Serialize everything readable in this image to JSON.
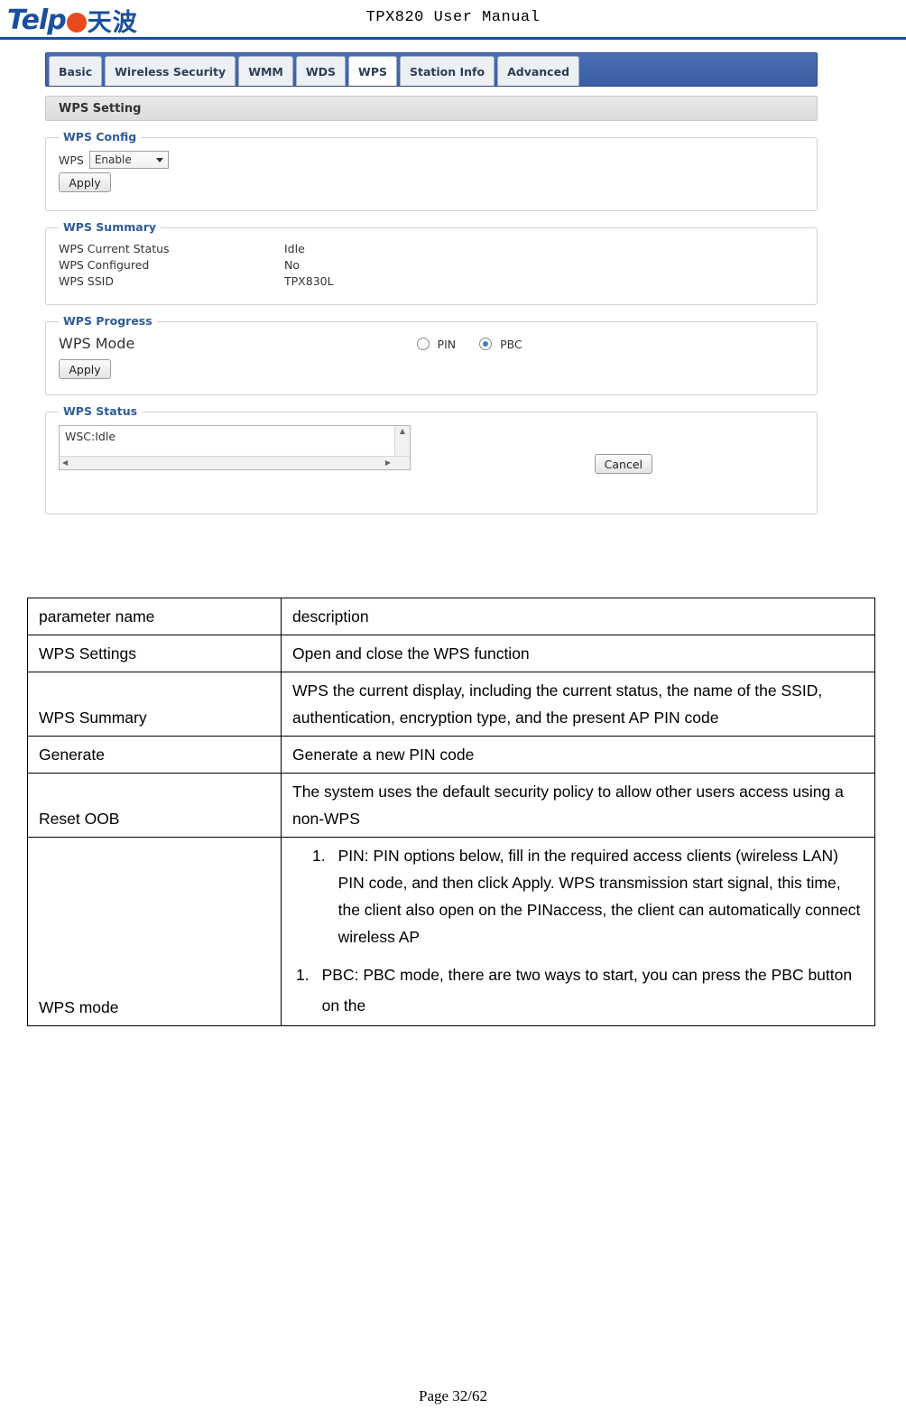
{
  "header": {
    "logo_text": "Telp",
    "logo_cn": "天波",
    "title": "TPX820 User Manual"
  },
  "screenshot": {
    "tabs": [
      {
        "label": "Basic",
        "active": false
      },
      {
        "label": "Wireless Security",
        "active": false
      },
      {
        "label": "WMM",
        "active": false
      },
      {
        "label": "WDS",
        "active": false
      },
      {
        "label": "WPS",
        "active": true
      },
      {
        "label": "Station Info",
        "active": false
      },
      {
        "label": "Advanced",
        "active": false
      }
    ],
    "section_title": "WPS Setting",
    "wps_config": {
      "legend": "WPS Config",
      "label": "WPS",
      "select_value": "Enable",
      "apply_label": "Apply"
    },
    "wps_summary": {
      "legend": "WPS Summary",
      "rows": [
        {
          "key": "WPS Current Status",
          "value": "Idle"
        },
        {
          "key": "WPS Configured",
          "value": "No"
        },
        {
          "key": "WPS SSID",
          "value": "TPX830L"
        }
      ]
    },
    "wps_progress": {
      "legend": "WPS Progress",
      "label": "WPS Mode",
      "options": [
        {
          "label": "PIN",
          "selected": false
        },
        {
          "label": "PBC",
          "selected": true
        }
      ],
      "apply_label": "Apply"
    },
    "wps_status": {
      "legend": "WPS Status",
      "text": "WSC:Idle",
      "cancel_label": "Cancel"
    }
  },
  "table": {
    "head": {
      "param": "parameter name",
      "desc": "description"
    },
    "rows": [
      {
        "param": "WPS Settings",
        "desc": "Open and close the WPS function"
      },
      {
        "param": "WPS Summary",
        "desc": "WPS the current display, including the current status, the name of the SSID, authentication, encryption type, and the present AP PIN code"
      },
      {
        "param": "Generate",
        "desc": "Generate a new PIN code"
      },
      {
        "param": "Reset OOB",
        "desc": "The system uses the default security policy to allow other users access using a non-WPS"
      }
    ],
    "wps_mode": {
      "param": "WPS mode",
      "item1_num": "1.",
      "item1_text": "PIN: PIN options below, fill in the required access clients (wireless LAN) PIN code, and then click Apply. WPS transmission start signal, this time, the client also open on the PINaccess, the client can automatically connect wireless AP",
      "item2_num": "1.",
      "item2_text": "PBC: PBC mode, there are two ways to start, you can press the PBC button on the"
    }
  },
  "footer": {
    "page": "Page 32/62"
  }
}
